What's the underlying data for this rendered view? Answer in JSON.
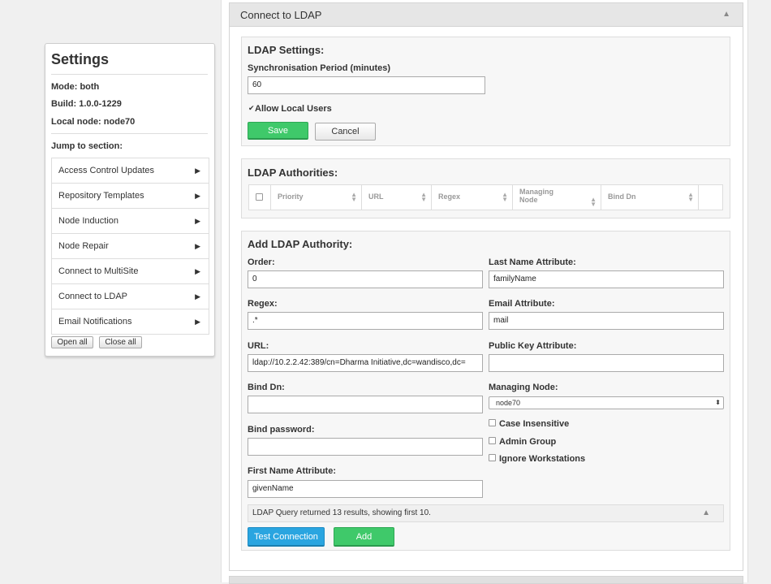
{
  "settings": {
    "title": "Settings",
    "mode": "Mode: both",
    "build": "Build: 1.0.0-1229",
    "local_node": "Local node: node70",
    "jump_label": "Jump to section:",
    "sections": [
      {
        "label": "Access Control Updates"
      },
      {
        "label": "Repository Templates"
      },
      {
        "label": "Node Induction"
      },
      {
        "label": "Node Repair"
      },
      {
        "label": "Connect to MultiSite"
      },
      {
        "label": "Connect to LDAP"
      },
      {
        "label": "Email Notifications"
      }
    ],
    "arrow_glyph": "▶",
    "open_all": "Open all",
    "close_all": "Close all"
  },
  "ldap_panel": {
    "title": "Connect to LDAP",
    "collapse_glyph": "▲"
  },
  "ldap_settings": {
    "title": "LDAP Settings:",
    "sync_label": "Synchronisation Period (minutes)",
    "sync_value": "60",
    "allow_local_label": "Allow Local Users",
    "allow_local_checked": true,
    "save": "Save",
    "cancel": "Cancel"
  },
  "authorities": {
    "title": "LDAP Authorities:",
    "columns": [
      "Priority",
      "URL",
      "Regex",
      "Managing Node",
      "Bind Dn"
    ]
  },
  "add_authority": {
    "title": "Add LDAP Authority:",
    "order_label": "Order:",
    "order_value": "0",
    "regex_label": "Regex:",
    "regex_value": ".*",
    "url_label": "URL:",
    "url_value": "ldap://10.2.2.42:389/cn=Dharma Initiative,dc=wandisco,dc=",
    "bind_dn_label": "Bind Dn:",
    "bind_dn_value": "",
    "bind_password_label": "Bind password:",
    "bind_password_value": "",
    "first_name_label": "First Name Attribute:",
    "first_name_value": "givenName",
    "last_name_label": "Last Name Attribute:",
    "last_name_value": "familyName",
    "email_label": "Email Attribute:",
    "email_value": "mail",
    "public_key_label": "Public Key Attribute:",
    "public_key_value": "",
    "managing_node_label": "Managing Node:",
    "managing_node_value": "node70",
    "case_insensitive_label": "Case Insensitive",
    "admin_group_label": "Admin Group",
    "ignore_workstations_label": "Ignore Workstations",
    "status_text": "LDAP Query returned 13 results, showing first 10.",
    "test_connection": "Test Connection",
    "add": "Add"
  },
  "colors": {
    "accent_green": "#3fc96a",
    "accent_blue": "#2aa5e0"
  }
}
